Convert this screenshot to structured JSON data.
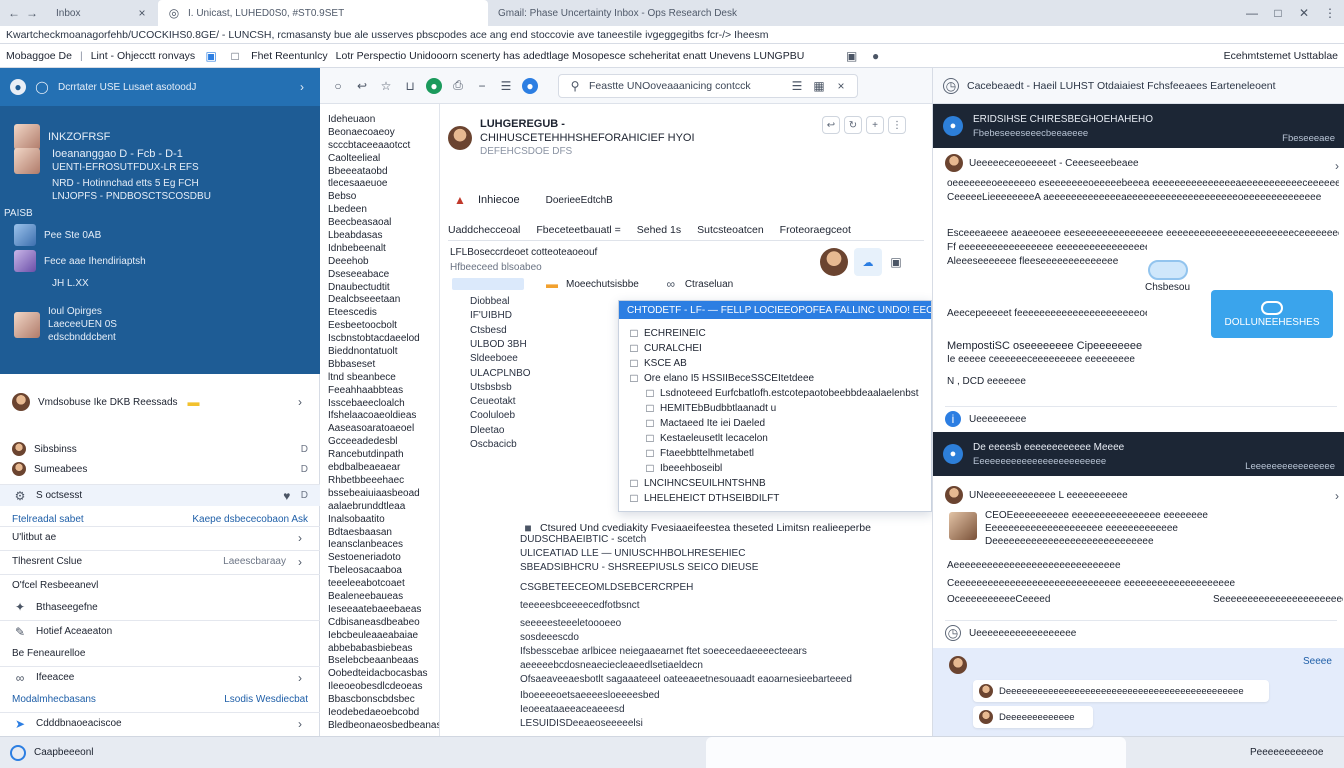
{
  "browser": {
    "tabs": [
      {
        "label": "Inbox"
      },
      {
        "label": "I. Unicast, LUHED0S0, #ST0.9SET"
      },
      {
        "label": "Gmail: Phase Uncertainty Inbox - Ops Research Desk"
      }
    ],
    "url": "Kwartcheckmoanagorfehb/UCOCKIHS0.8GE/ - LUNCSH, rcmasansty bue ale usserves pbscpodes ace ang end stoccovie ave taneestile ivgeggegitbs fcr-/> Iheesm",
    "bookmarks": [
      "Mobaggoe De",
      "Lint - Ohjecctt ronvays",
      "Fhet Reentunlcy",
      "Lotr Perspectio Unidooorn scenerty has adedtlage Mosopesce scheheritat enatt Unevens LUNGPBU",
      "Ecehmtstemet Usttablae"
    ]
  },
  "left_panel": {
    "title": "Dcrrtater USE Lusaet asotoodJ",
    "items": [
      {
        "title": "INKZOFRSF",
        "meta": ""
      },
      {
        "title": "Ioeananggao D - Fcb - D-1",
        "meta": "UENTI-EFROSUTFDUX-LR EFS"
      },
      {
        "title": "NRD - Hotinnchad etts 5 Eg FCH",
        "meta": "LNJOPFS - PNDBOSCTSCOSDBU"
      },
      {
        "title": "PAISB",
        "meta": "Pee Ste 0AB"
      },
      {
        "title": "Fece aae Ihendiriaptsh",
        "meta": "JH L.XX"
      },
      {
        "title": "Ioul Opirges",
        "meta": "LaeceeUEN 0S"
      },
      {
        "title": "edscbnddcbent",
        "meta": ""
      }
    ]
  },
  "left_list": {
    "header": "Vmdsobuse Ike DKB Reessads",
    "rows": [
      {
        "label": "Sibsbinss",
        "right": "D"
      },
      {
        "label": "Sumeabees",
        "right": "D"
      },
      {
        "label": "S octsesst",
        "right": "D"
      },
      {
        "label": "Ftelreadal sabet",
        "right": "Kaepe dsbececobaon   Ask"
      },
      {
        "label": "U'litbut ae",
        "right": ""
      },
      {
        "label": "Tlhesrent Cslue",
        "right": "Laeescbaraay"
      },
      {
        "label": "O'fcel Resbeeanevl",
        "right": ""
      },
      {
        "label": "Bthaseegefne",
        "right": ""
      },
      {
        "label": "Hotief Aceaeaton",
        "right": ""
      },
      {
        "label": "Be Feneaurelloe",
        "right": ""
      },
      {
        "label": "Ifeeacee",
        "right": ""
      },
      {
        "label": "Modalmhecbasans",
        "right": "Lsodis Wesdiecbat"
      },
      {
        "label": "Cdddbnaoeaciscoe",
        "right": ""
      }
    ]
  },
  "mid_toolbar": {
    "search": "Feastte UNOoveaaanicing contcck"
  },
  "folders": [
    "Ideheuaon",
    "Beonaecoaeoy",
    "scccbtaceeaaotcct",
    "Caolteelieal",
    "Bbeeeataobd",
    "tlecesaaeuoe",
    "Bebso",
    "Lbedeen",
    "Beecbeasaoal",
    "Lbeabdasas",
    "Idnbebeenalt",
    "Deeehob",
    "Dseseeabace",
    "Dnaubectudtit",
    "Dealcbseeetaan",
    "Eteescedis",
    "Eesbeetoocbolt",
    "Iscbnstobtacdaeelod",
    "Bieddnontatuolt",
    "Bbbaseset",
    "ltnd sbeanbece",
    "Feeahhaabbteas",
    "Isscebaeecloalch",
    "Ifshelaacoaeoldieas",
    "Aaseasoaratoaeoel",
    "Gcceeadedesbl",
    "Rancebutdinpath",
    "ebdbalbeaeaear",
    "Rhbetbbeeehaec",
    "bssebeaiuiaasbeoad",
    "aalaebrunddtleaa",
    "Inalsobaatito",
    "Bdtaesbaasan",
    "Ieansclanbeaces",
    "Sestoeneriadoto",
    "Tbeleosacaaboa",
    "teeeleeabotcoaet",
    "Bealeneebaueas",
    "Ieseeaatebaeebaeas",
    "Cdbisaneasdbeabeo",
    "Iebcbeuleaaeabaiae",
    "abbebabasbiebeas",
    "Bselebcbeaanbeaas",
    "Oobedteidacbocasbas",
    "Ileeoeobesdlcdeoeas",
    "Bbascbonscbdsbec",
    "Ieodebedaeoebcobd",
    "Bledbeonaeosbedbeanas"
  ],
  "email": {
    "from_name": "LUHGEREGUB -",
    "subject": "CHIHUSCETEHHHSHEFORAHICIEF HYOI",
    "date": "DEFEHCSDOE DFS",
    "section": "Inhiecoe",
    "section_meta": "DoerieeEdtchB",
    "tabs": [
      "Uaddchecceoal",
      "Fbeceteetbauatl =",
      "Sehed 1s",
      "Sutcsteoatcen",
      "Froteoraegceot"
    ],
    "intro": "LFLBoseccrdeoet cotteoteaoeouf",
    "intro2": "Hfbeeceed blsoabeo",
    "reply_line": "Moeechutsisbbe",
    "reply_meta": "Ctraseluan",
    "thread": [
      "Diobbeal",
      "IF'UIBHD",
      "Ctsbesd",
      "ULBOD 3BH",
      "Sldeeboee",
      "ULACPLNBO",
      "Utsbsbsb",
      "Ceueotakt",
      "Cooluloeb",
      "Dleetao",
      "Oscbacicb"
    ],
    "dropdown": {
      "head": "CHTODETF - LF- — FELLP LOCIEEOPOFEA FALLINC UNDO! EEOUNDDOCOCHTE",
      "items": [
        "ECHREINEIC",
        "CURALCHEI",
        "KSCE AB",
        "Ore elano I5 HSSIIBeceSSCEItetdeee",
        "Lsdnoteeed Eurfcbatlofh.estcotepaotobeebbdeaalaelenbst",
        "HEMITEbBudbbtlaanadt u",
        "Mactaeed Ite iei Daeled",
        "Kestaeleusetlt lecacelon",
        "Ftaeebbttelhmetabetl",
        "Ibeeehboseibl",
        "LNCIHNCSEUILHNTSHNB",
        "LHELEHEICT DTHSEIBDILFT"
      ]
    },
    "body_heading": "Ctsured Und cvediakity Fvesiaaeifeestea theseted Limitsn realieeperbe",
    "body_lines": [
      "DUDSCHBAEIBTIC - scetch",
      "ULICEATIAD LLE — UNIUSCHHBOLHRESEHIEC",
      "SBEADSIBHCRU - SHSREEPIUSLS SEICO DIEUSE",
      "CSGBETEECEOMLDSEBCERCRPEH",
      "teeeeesbceeeecedfotbsnct",
      "seeeeesteeeletoooeeo",
      "sosdeeescdo",
      "Ifsbesscebae arlbicee neiegaaearnet ftet soeeceedaeeeecteears",
      "aeeeeebcdosneaeciecleaeedlsetiaeldecn",
      "Ofsaeaveeaesbotlt sagaaateeel oateeaeetnesouaadt eaoarnesieebarteeed",
      "Iboeeeeoetsaeeeesloeeeesbed",
      "Ieoeeataaeeaceaeeesd",
      "LESUIDISDeeaeoseeeeelsi"
    ]
  },
  "right_panel": {
    "top_title": "Cacebeaedt - Haeil LUHST Otdaiaiest Fchsfeeaees Earteneleoent",
    "card1_title": "ERIDSIHSE CHIRESBEGHOEHAHEHO",
    "card1_sub": "Fbebeseeeseeecbeeaeeee",
    "card1_meta": "Fbeseeeaee",
    "sender1": "Ueeeeeceeoeeeeet - Ceeeseeebeaee",
    "sender1_text": "oeeeeeeeoeeeeeeo eseeeeeeeoeeeeebeeea eeeeeeeeeeeeeeeaeeeeeeeeeeeceeeeeeeeee",
    "sender1_text2": "CeeeeeLieeeeeeeeA aeeeeeeeeeeeeeaeeeeeeeeeeeeeeeeeeeeoeeeeeeeeeeeeee",
    "p1": "Esceeeaeeee aeaeeoeee eeseeeeeeeeeeeeeee eeeeeeeeeeeeeeeeeeeeeeeceeeeeeeeeeeeeee",
    "p2": "Ff eeeeeeeeeeeeeeeee eeeeeeeeeeeeeeeeeeeee",
    "p3": "Aleeeseeeeeee fleeseeeeeeeeeeeeee",
    "cloud_label": "Chsbesou",
    "cloud_btn": "DOLLUNEEHESHES",
    "p4": "Aeecepeeeeet feeeeeeeeeeeeeeeeeeeeeeoeeeeeeeeee",
    "p5": "MempostiSC oseeeeeeee Cipeeeeeeee",
    "p6": "Ie eeeee ceeeeeeceeeeeeeee eeeeeeeee",
    "p7": "N , DCD eeeeeee",
    "row1": "Ueeeeeeeee",
    "card2_title": "De eeeesb eeeeeeeeeeee Meeee",
    "card2_sub": "Eeeeeeeeeeeeeeeeeeeeeeeee",
    "card2_meta": "Leeeeeeeeeeeeeeee",
    "sender2": "UNeeeeeeeeeeeee L eeeeeeeeeee",
    "sender2_a": "CEOEeeeeeeeeee eeeeeeeeeeeeeeee eeeeeeee",
    "sender2_b": "Eeeeeeeeeeeeeeeeeeeee eeeeeeeeeeeee",
    "sender2_c": "Deeeeeeeeeeeeeeeeeeeeeeeeeeeee",
    "p8": "Aeeeeeeeeeeeeeeeeeeeeeeeeeeeeee",
    "p9": "Ceeeeeeeeeeeeeeeeeeeeeeeeeeeeee eeeeeeeeeeeeeeeeeeee",
    "p10": "OceeeeeeeeeeCeeeed",
    "p10b": "Seeeeeeeeeeeeeeeeeeeeeeeeee",
    "row2": "Ueeeeeeeeeeeeeeeeee",
    "chat_meta": "Seeee",
    "chat_msgs": [
      "Deeeeeeeeeeeeeeeeeeeeeeeeeeeeeeeeeeeeeeeeeeeee",
      "Deeeeeeeeeeeee"
    ]
  },
  "status": {
    "left": "Caapbeeeonl",
    "right": "Peeeeeeeeeeoe"
  },
  "colors": {
    "accent": "#2c7ee2",
    "left_panel": "#1e5c95",
    "dark_card": "#1c2635"
  }
}
